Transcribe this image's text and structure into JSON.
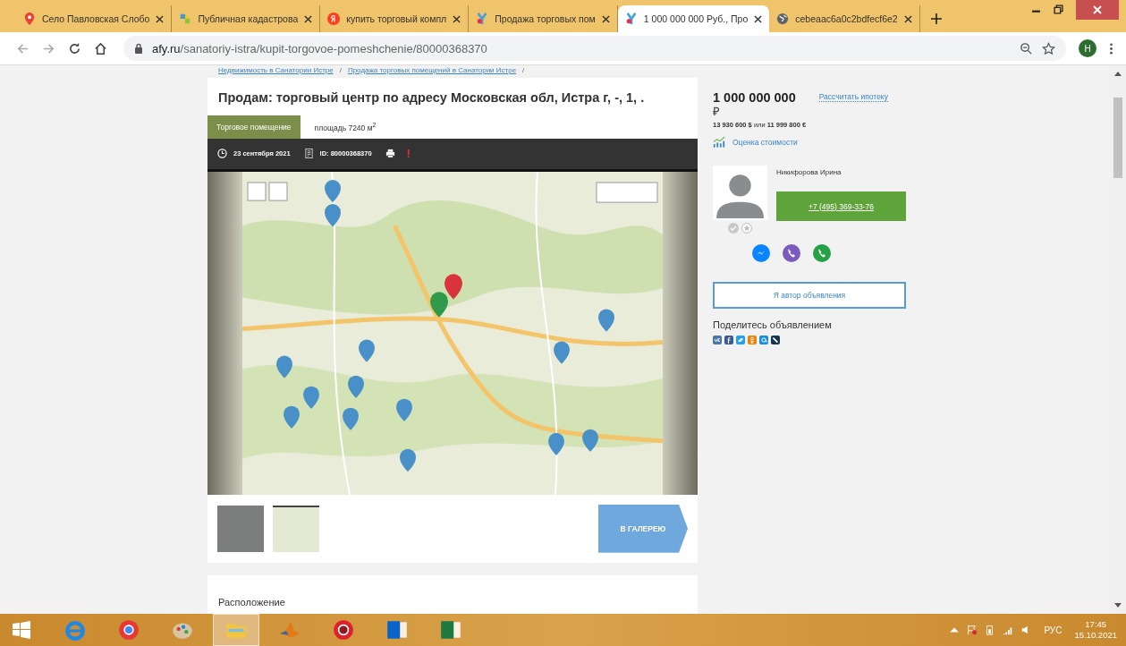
{
  "browser": {
    "tabs": [
      {
        "title": "Село Павловская Слобо",
        "kind": "pin",
        "selected": false
      },
      {
        "title": "Публичная кадастрова",
        "kind": "parcel",
        "selected": false
      },
      {
        "title": "купить торговый компл",
        "kind": "yandex",
        "selected": false
      },
      {
        "title": "Продажа торговых пом",
        "kind": "afy",
        "selected": false
      },
      {
        "title": "1 000 000 000 Руб., Про",
        "kind": "afy",
        "selected": true
      },
      {
        "title": "cebeaac6a0c2bdfecf6e2",
        "kind": "globe",
        "selected": false
      }
    ],
    "url_host": "afy.ru",
    "url_path": "/sanatoriy-istra/kupit-torgovoe-pomeshchenie/80000368370",
    "profile_initial": "Н"
  },
  "breadcrumbs": [
    {
      "label": "Недвижимость в Санатории Истре"
    },
    {
      "label": "Продажа торговых помещений в Санатории Истре"
    }
  ],
  "breadcrumb_separator": "/",
  "listing": {
    "title": "Продам: торговый центр по адресу Московская обл, Истра г, -, 1, .",
    "category": "Торговое помещение",
    "area": "площадь 7240 м$^{2}$",
    "date": "23 сентября 2021",
    "id": "ID: 80000368370",
    "report_mark": "!"
  },
  "gallery": {
    "thumbnails": [
      {
        "kind": "photo",
        "selected": false
      },
      {
        "kind": "map",
        "selected": true
      }
    ],
    "button": "В ГАЛЕРЕЮ"
  },
  "location_heading": "Расположение",
  "price": {
    "amount": "1 000 000 000",
    "currency": "₽",
    "mortgage_link": "Рассчитать ипотеку",
    "conversion": "**13 930 600 $** или **11 999 800 €**",
    "valuation_link": "Оценка стоимости"
  },
  "agent": {
    "name": "Никифорова Ирина",
    "phone": "+7 (495) 369-33-76",
    "verified": false
  },
  "author_button": "Я автор объявления",
  "share": {
    "heading": "Поделитесь объявлением",
    "networks": [
      {
        "kind": "vk",
        "color": "#4a76a8"
      },
      {
        "kind": "facebook",
        "color": "#3b5998"
      },
      {
        "kind": "twitter",
        "color": "#1da1f2"
      },
      {
        "kind": "odnoklassniki",
        "color": "#ee8208"
      },
      {
        "kind": "mailru",
        "color": "#168de2"
      },
      {
        "kind": "livejournal",
        "color": "#15374c"
      }
    ]
  },
  "taskbar": {
    "apps": [
      {
        "kind": "ie",
        "selected": false
      },
      {
        "kind": "chrome",
        "selected": false
      },
      {
        "kind": "paint",
        "selected": false
      },
      {
        "kind": "explorer",
        "selected": true
      },
      {
        "kind": "matlab",
        "selected": false
      },
      {
        "kind": "opera",
        "selected": false
      },
      {
        "kind": "outlook",
        "selected": false
      },
      {
        "kind": "excel",
        "selected": false
      }
    ],
    "language": "РУС",
    "time": "17:45",
    "date": "15.10.2021"
  }
}
